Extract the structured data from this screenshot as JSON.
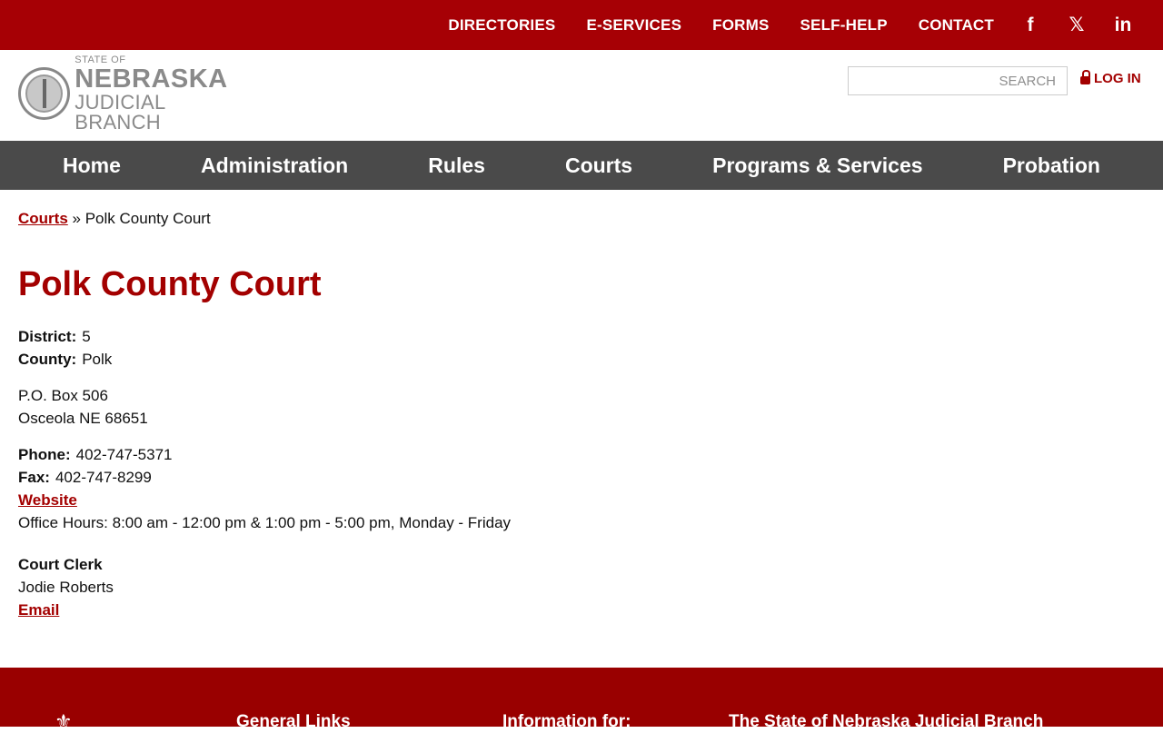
{
  "topbar": {
    "links": [
      "DIRECTORIES",
      "E-SERVICES",
      "FORMS",
      "SELF-HELP",
      "CONTACT"
    ],
    "social": [
      {
        "name": "facebook-icon",
        "glyph": "f"
      },
      {
        "name": "x-icon",
        "glyph": "𝕏"
      },
      {
        "name": "linkedin-icon",
        "glyph": "in"
      }
    ]
  },
  "header": {
    "logo_line1": "STATE OF",
    "logo_line2": "NEBRASKA",
    "logo_line3": "JUDICIAL BRANCH",
    "search_placeholder": "SEARCH",
    "login_label": "LOG IN"
  },
  "nav": {
    "items": [
      "Home",
      "Administration",
      "Rules",
      "Courts",
      "Programs & Services",
      "Probation"
    ]
  },
  "breadcrumb": {
    "parent": "Courts",
    "separator": "»",
    "current": "Polk County Court"
  },
  "page": {
    "title": "Polk County Court",
    "district_label": "District:",
    "district": "5",
    "county_label": "County:",
    "county": "Polk",
    "address_line1": "P.O. Box 506",
    "address_line2": "Osceola NE 68651",
    "phone_label": "Phone:",
    "phone": "402-747-5371",
    "fax_label": "Fax:",
    "fax": "402-747-8299",
    "website_label": "Website",
    "office_hours": "Office Hours: 8:00 am - 12:00 pm & 1:00 pm - 5:00 pm, Monday - Friday",
    "clerk_heading": "Court Clerk",
    "clerk_name": "Jodie Roberts",
    "email_label": "Email"
  },
  "footer": {
    "headings": [
      "General Links",
      "Information for:",
      "The State of Nebraska Judicial Branch"
    ]
  },
  "colors": {
    "brand_red": "#a60005",
    "footer_red": "#990000",
    "nav_gray": "#4a4a4a"
  }
}
